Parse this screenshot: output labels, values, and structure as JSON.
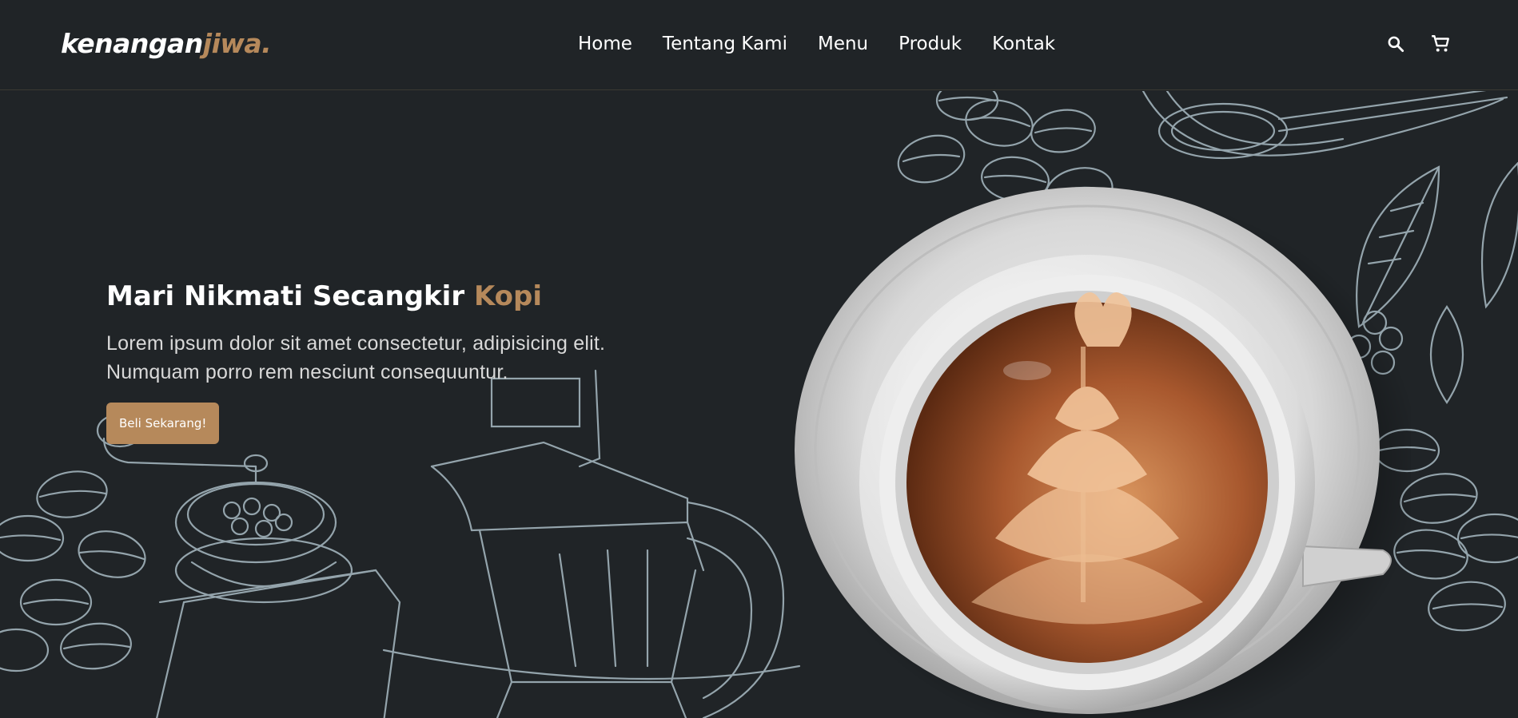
{
  "brand": {
    "name": "kenangan",
    "accent": "jiwa."
  },
  "nav": {
    "links": [
      "Home",
      "Tentang Kami",
      "Menu",
      "Produk",
      "Kontak"
    ],
    "icons": [
      "search-icon",
      "shopping-cart-icon"
    ]
  },
  "hero": {
    "title": "Mari Nikmati Secangkir ",
    "title_accent": "Kopi",
    "text": "Lorem ipsum dolor sit amet consectetur, adipisicing elit. Numquam porro rem nesciunt consequuntur.",
    "cta_label": "Beli Sekarang!"
  },
  "colors": {
    "background": "#202427",
    "accent": "#b6895b",
    "text": "#ffffff",
    "sketch_line": "#a9bcc4"
  }
}
